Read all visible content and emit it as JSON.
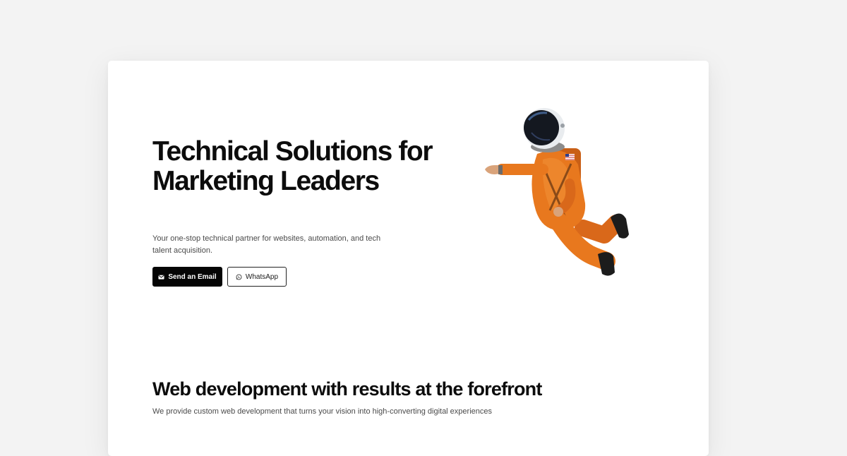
{
  "hero": {
    "title": "Technical Solutions for Marketing Leaders",
    "subtitle": "Your one-stop technical partner for websites, automation, and tech talent acquisition.",
    "email_button_label": "Send an Email",
    "whatsapp_button_label": "WhatsApp",
    "email_icon": "mail-icon",
    "whatsapp_icon": "whatsapp-icon",
    "illustration": "astronaut-illustration"
  },
  "section": {
    "title": "Web development with results at the forefront",
    "subtitle": "We provide custom web development that turns your vision into high-converting digital experiences"
  },
  "colors": {
    "page_background": "#f3f3f3",
    "card_background": "#ffffff",
    "primary_button": "#050505",
    "text_primary": "#0c0c0c",
    "text_secondary": "#4a4a4a",
    "suit_orange": "#e8781e"
  }
}
